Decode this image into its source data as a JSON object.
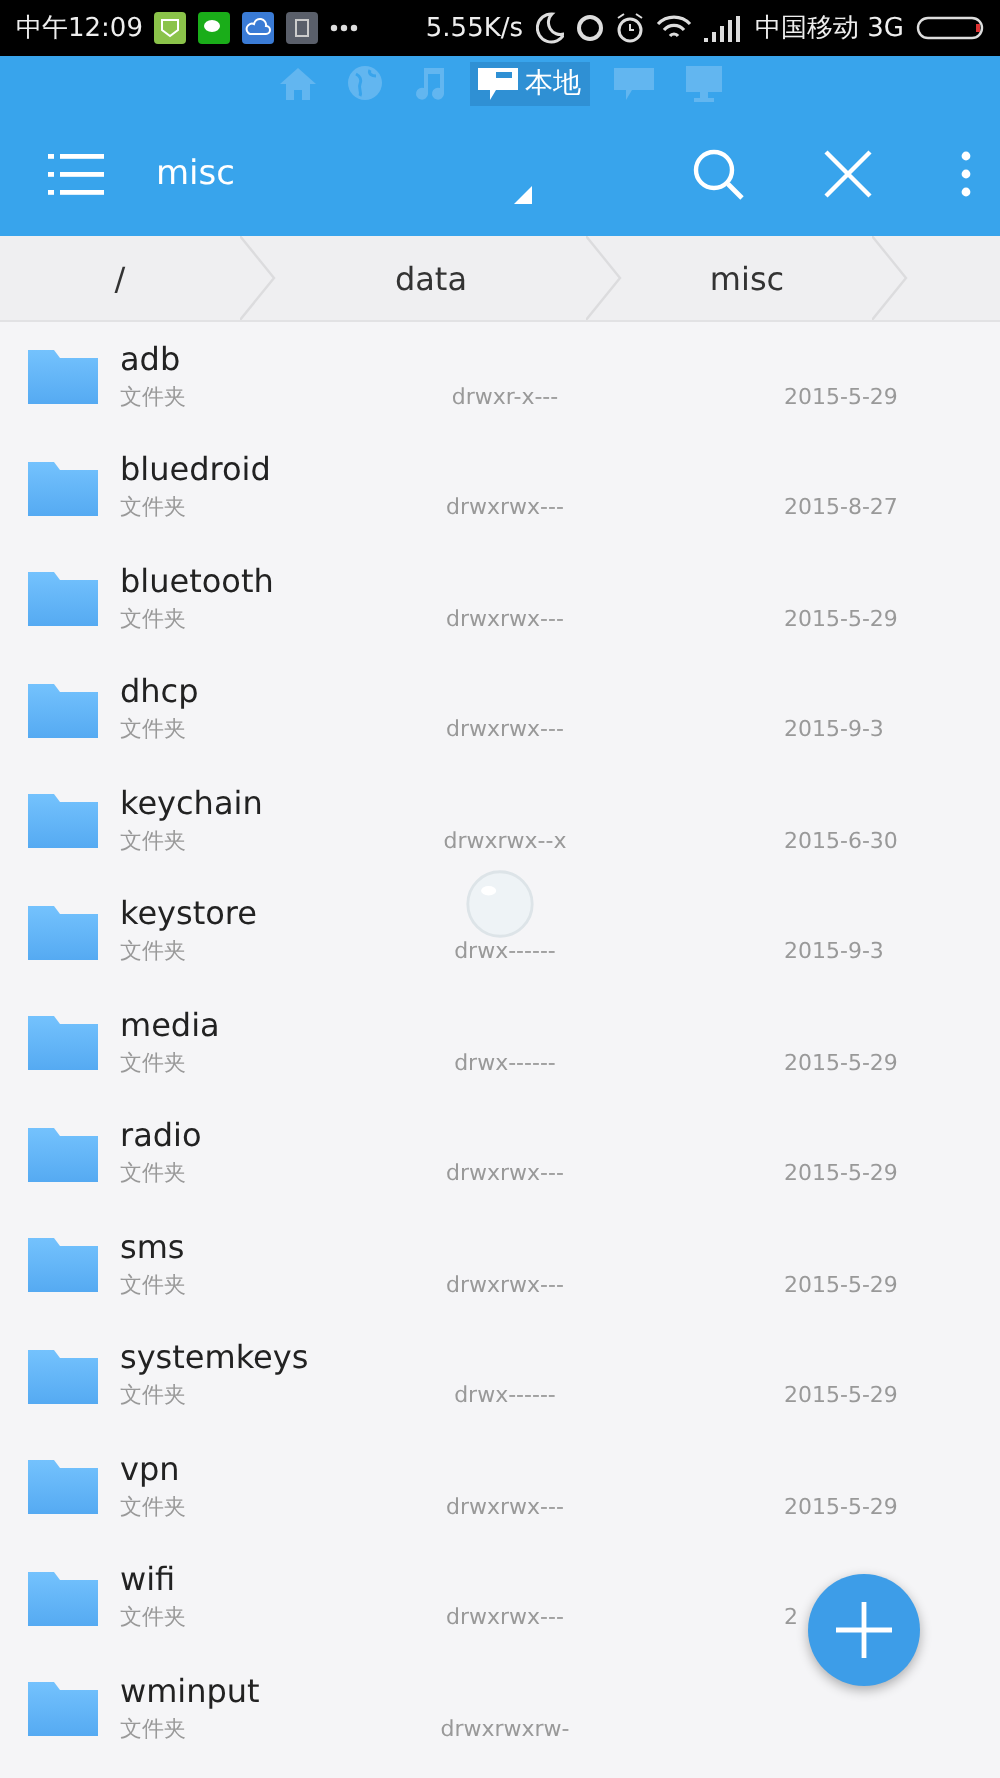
{
  "status_bar": {
    "time": "中午12:09",
    "speed": "5.55K/s",
    "carrier": "中国移动 3G"
  },
  "tabs": [
    {
      "kind": "home",
      "selected": false
    },
    {
      "kind": "globe",
      "selected": false
    },
    {
      "kind": "music",
      "selected": false
    },
    {
      "kind": "local",
      "label": "本地",
      "selected": true
    },
    {
      "kind": "remote",
      "selected": false
    },
    {
      "kind": "wifi",
      "selected": false
    }
  ],
  "toolbar": {
    "title": "misc"
  },
  "breadcrumb": [
    "/",
    "data",
    "misc"
  ],
  "files": [
    {
      "name": "adb",
      "type": "文件夹",
      "permissions": "drwxr-x---",
      "date": "2015-5-29"
    },
    {
      "name": "bluedroid",
      "type": "文件夹",
      "permissions": "drwxrwx---",
      "date": "2015-8-27"
    },
    {
      "name": "bluetooth",
      "type": "文件夹",
      "permissions": "drwxrwx---",
      "date": "2015-5-29"
    },
    {
      "name": "dhcp",
      "type": "文件夹",
      "permissions": "drwxrwx---",
      "date": "2015-9-3"
    },
    {
      "name": "keychain",
      "type": "文件夹",
      "permissions": "drwxrwx--x",
      "date": "2015-6-30"
    },
    {
      "name": "keystore",
      "type": "文件夹",
      "permissions": "drwx------",
      "date": "2015-9-3"
    },
    {
      "name": "media",
      "type": "文件夹",
      "permissions": "drwx------",
      "date": "2015-5-29"
    },
    {
      "name": "radio",
      "type": "文件夹",
      "permissions": "drwxrwx---",
      "date": "2015-5-29"
    },
    {
      "name": "sms",
      "type": "文件夹",
      "permissions": "drwxrwx---",
      "date": "2015-5-29"
    },
    {
      "name": "systemkeys",
      "type": "文件夹",
      "permissions": "drwx------",
      "date": "2015-5-29"
    },
    {
      "name": "vpn",
      "type": "文件夹",
      "permissions": "drwxrwx---",
      "date": "2015-5-29"
    },
    {
      "name": "wifi",
      "type": "文件夹",
      "permissions": "drwxrwx---",
      "date": "2"
    },
    {
      "name": "wminput",
      "type": "文件夹",
      "permissions": "drwxrwxrw-"
    }
  ]
}
